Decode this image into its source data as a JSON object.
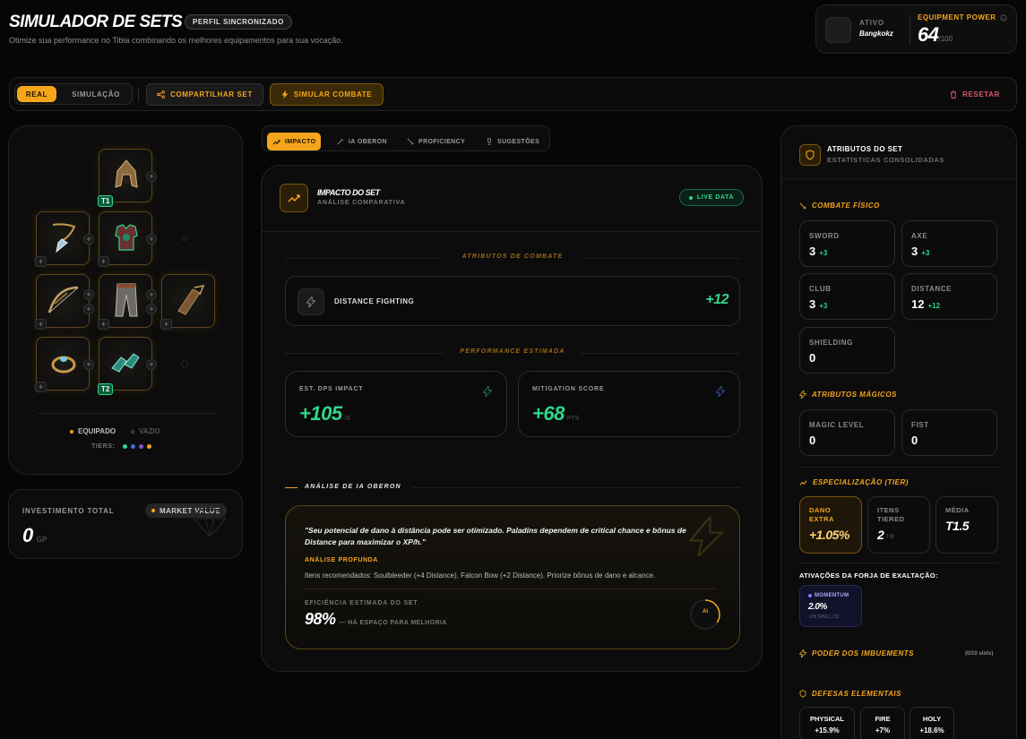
{
  "header": {
    "title": "SIMULADOR DE SETS",
    "badge": "PERFIL SINCRONIZADO",
    "subtitle": "Otimize sua performance no Tibia combinando os melhores equipamentos para sua vocação.",
    "active_label": "ATIVO",
    "active_name": "Bangkokz",
    "power_label": "EQUIPMENT POWER",
    "power_value": "64",
    "power_max": "/100"
  },
  "toolbar": {
    "mode_real": "REAL",
    "mode_sim": "SIMULAÇÃO",
    "share": "COMPARTILHAR SET",
    "simulate": "SIMULAR COMBATE",
    "reset": "RESETAR"
  },
  "equipment": {
    "tiers_labels": [
      "T1",
      "T2"
    ],
    "legend_equipped": "EQUIPADO",
    "legend_empty": "VAZIO",
    "tiers_label": "TIERS:",
    "tier_colors": [
      "#2fd68a",
      "#3b6fd6",
      "#8a4fd6",
      "#f4a51c"
    ]
  },
  "investment": {
    "label": "INVESTIMENTO TOTAL",
    "market": "MARKET VALUE",
    "value": "0",
    "unit": "GP"
  },
  "tabs": [
    "IMPACTO",
    "IA OBERON",
    "PROFICIENCY",
    "SUGESTÕES"
  ],
  "impact": {
    "title": "IMPACTO DO SET",
    "subtitle": "ANÁLISE COMPARATIVA",
    "live": "LIVE DATA",
    "combat_div": "ATRIBUTOS DE COMBATE",
    "skill_name": "DISTANCE FIGHTING",
    "skill_value": "+12",
    "perf_div": "PERFORMANCE ESTIMADA",
    "dps_label": "EST. DPS IMPACT",
    "dps_value": "+105",
    "dps_unit": "/S",
    "mit_label": "MITIGATION SCORE",
    "mit_value": "+68",
    "mit_unit": "PTS",
    "ai_div": "ANÁLISE DE IA OBERON",
    "ai_quote": "\"Seu potencial de dano à distância pode ser otimizado. Paladins dependem de critical chance e bônus de Distance para maximizar o XP/h.\"",
    "ai_deep_label": "ANÁLISE PROFUNDA",
    "ai_deep_text": "Itens recomendados: Soulbleeder (+4 Distance), Falcon Bow (+2 Distance). Priorize bônus de dano e alcance.",
    "eff_label": "EFICIÊNCIA ESTIMADA DO SET",
    "eff_value": "98%",
    "eff_note": "— HÁ ESPAÇO PARA MELHORIA",
    "eff_fraction": 0.98,
    "ai_badge": "AI"
  },
  "attributes": {
    "title": "ATRIBUTOS DO SET",
    "subtitle": "ESTATÍSTICAS CONSOLIDADAS",
    "physical": "COMBATE FÍSICO",
    "stats": [
      {
        "name": "SWORD",
        "value": "3",
        "bonus": "+3"
      },
      {
        "name": "AXE",
        "value": "3",
        "bonus": "+3"
      },
      {
        "name": "CLUB",
        "value": "3",
        "bonus": "+3"
      },
      {
        "name": "DISTANCE",
        "value": "12",
        "bonus": "+12"
      },
      {
        "name": "SHIELDING",
        "value": "0",
        "bonus": ""
      }
    ],
    "magic": "ATRIBUTOS MÁGICOS",
    "magic_stats": [
      {
        "name": "MAGIC LEVEL",
        "value": "0"
      },
      {
        "name": "FIST",
        "value": "0"
      }
    ],
    "spec": "ESPECIALIZAÇÃO (TIER)",
    "spec_cards": [
      {
        "name": "DANO EXTRA",
        "value": "+1.05%",
        "sub": ""
      },
      {
        "name": "ITENS TIERED",
        "value": "2",
        "sub": "/ 8"
      },
      {
        "name": "MÉDIA",
        "value": "T1.5",
        "sub": ""
      }
    ],
    "forge": "ATIVAÇÕES DA FORJA DE EXALTAÇÃO:",
    "momentum_name": "MOMENTUM",
    "momentum_value": "2.0%",
    "momentum_sub": "~2S SPELL CD",
    "imbue": "PODER DOS IMBUEMENTS",
    "imbue_slots": "(0/10 slots)",
    "defense": "DEFESAS ELEMENTAIS",
    "defenses": [
      {
        "name": "PHYSICAL",
        "value": "+15.9%"
      },
      {
        "name": "FIRE",
        "value": "+7%"
      },
      {
        "name": "HOLY",
        "value": "+18.6%"
      }
    ]
  }
}
